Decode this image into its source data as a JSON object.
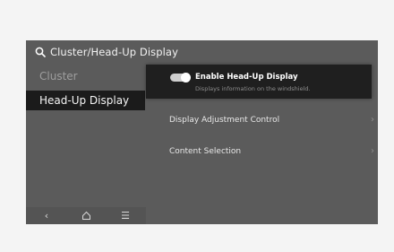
{
  "header": {
    "breadcrumb": "Cluster/Head-Up Display"
  },
  "sidebar": {
    "items": [
      {
        "label": "Cluster"
      },
      {
        "label": "Head-Up Display"
      }
    ]
  },
  "content": {
    "hud_toggle": {
      "title": "Enable Head-Up Display",
      "subtitle": "Displays information on the windshield.",
      "enabled": true
    },
    "rows": [
      {
        "label": "Display Adjustment Control",
        "chevron": "›"
      },
      {
        "label": "Content Selection",
        "chevron": "›"
      }
    ]
  },
  "bottom_nav": {
    "back_glyph": "‹",
    "home_icon": "home-icon",
    "menu_glyph": "☰"
  }
}
